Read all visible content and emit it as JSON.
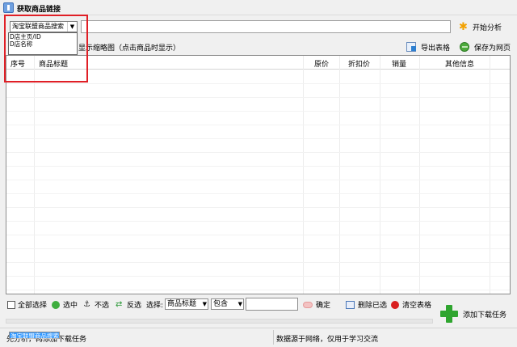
{
  "window": {
    "title": "获取商品链接"
  },
  "search": {
    "combo_value": "淘宝联盟商品搜索",
    "options": [
      "D店主页/ID",
      "D店名称",
      "淘宝联盟商品搜索"
    ],
    "start_label": "开始分析"
  },
  "toolbar": {
    "thumbnail_text": "显示缩略图（点击商品时显示）",
    "export_label": "导出表格",
    "save_web_label": "保存为网页"
  },
  "table": {
    "columns": [
      "序号",
      "商品标题",
      "原价",
      "折扣价",
      "销量",
      "其他信息"
    ],
    "rows": []
  },
  "bottom": {
    "select_all": "全部选择",
    "checked": "选中",
    "uncheck": "不选",
    "invert": "反选",
    "select_label": "选择:",
    "field_select": "商品标题",
    "match_select": "包含",
    "confirm": "确定",
    "delete_selected": "删除已选",
    "clear_table": "清空表格",
    "add_download": "添加下载任务"
  },
  "status": {
    "left": "先分析，再添加下载任务",
    "right": "数据源于网络，仅用于学习交流"
  }
}
